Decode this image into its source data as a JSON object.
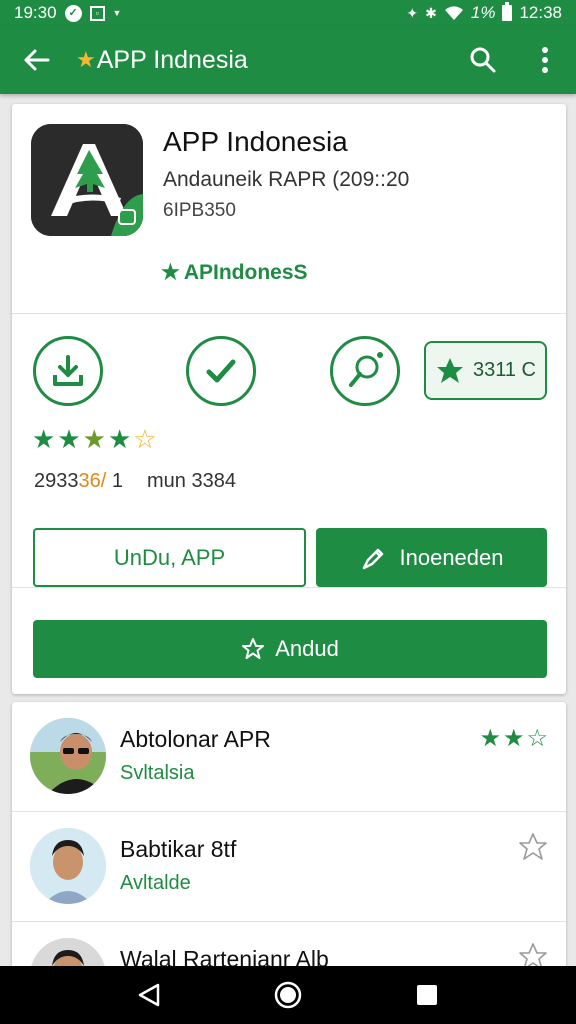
{
  "status_bar": {
    "time_left": "19:30",
    "battery_text": "1%",
    "time_right": "12:38"
  },
  "app_bar": {
    "title": "APP Indnesia",
    "title_icon": "star-icon",
    "back_icon": "arrow-left-icon",
    "search_icon": "search-icon",
    "menu_icon": "more-vert-icon"
  },
  "app": {
    "name": "APP Indonesia",
    "developer": "Andauneik RAPR (209::20",
    "size": "6IPB350",
    "badge": "APIndonesS"
  },
  "actions": {
    "download_icon": "download-icon",
    "installed_icon": "check-circle-icon",
    "search_icon": "magnifier-icon",
    "rating_pill": "3311 C"
  },
  "rating": {
    "stars": 4,
    "stats_a": "2933",
    "stats_hl": "36/",
    "stats_b": "1",
    "stats_c": "mun 3384"
  },
  "buttons": {
    "outline_label": "UnDu, APP",
    "solid_label": "Inoeneden",
    "wide_label": "Andud"
  },
  "reviews": [
    {
      "title": "Abtolonar APR",
      "subtitle": "Svltalsia",
      "stars": 3
    },
    {
      "title": "Babtikar 8tf",
      "subtitle": "Avltalde",
      "stars": 0
    },
    {
      "title": "Walal Rartenianr Alb",
      "subtitle": "",
      "stars": 0
    }
  ],
  "colors": {
    "primary": "#1f8c43",
    "star_gold": "#f0b323",
    "background": "#e9e9e9"
  },
  "nav": {
    "back_icon": "triangle-back-icon",
    "home_icon": "circle-home-icon",
    "recents_icon": "square-recents-icon"
  }
}
